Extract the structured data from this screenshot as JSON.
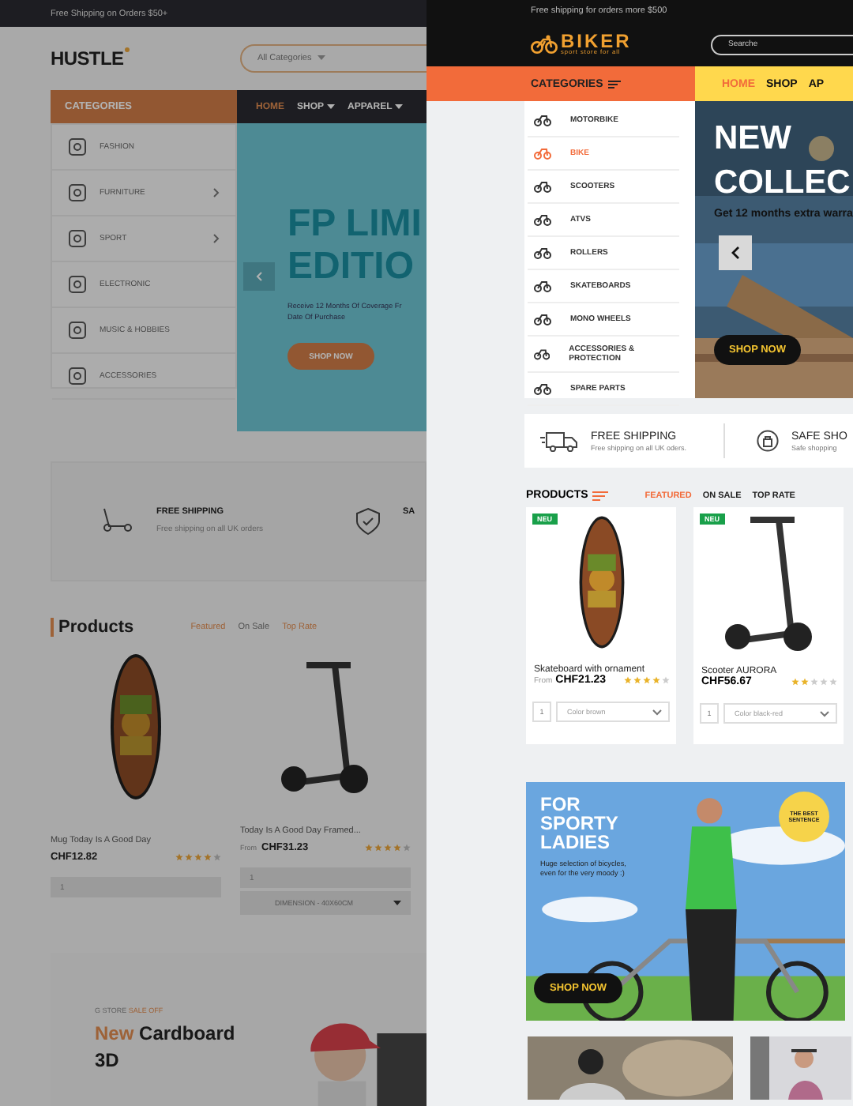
{
  "left_site": {
    "top_bar": "Free Shipping on Orders $50+",
    "logo": "HUSTLE",
    "search": {
      "category": "All Categories"
    },
    "categories_title": "CATEGORIES",
    "nav": [
      {
        "label": "HOME",
        "selected": true,
        "dropdown": false
      },
      {
        "label": "SHOP",
        "selected": false,
        "dropdown": true
      },
      {
        "label": "APPAREL",
        "selected": false,
        "dropdown": true
      }
    ],
    "categories": [
      {
        "label": "FASHION",
        "submenu": false
      },
      {
        "label": "FURNITURE",
        "submenu": true
      },
      {
        "label": "SPORT",
        "submenu": true
      },
      {
        "label": "ELECTRONIC",
        "submenu": false
      },
      {
        "label": "MUSIC & HOBBIES",
        "submenu": false
      },
      {
        "label": "ACCESSORIES",
        "submenu": false
      }
    ],
    "hero": {
      "title_lines": [
        "FP LIMI",
        "EDITIO"
      ],
      "text_lines": [
        "Receive 12 Months Of Coverage Fr",
        "Date Of Purchase"
      ],
      "button": "SHOP NOW"
    },
    "features": [
      {
        "title": "FREE SHIPPING",
        "text": "Free shipping on all UK orders"
      },
      {
        "title": "SA"
      }
    ],
    "products_title": "Products",
    "product_tabs": [
      {
        "label": "Featured",
        "highlighted": true
      },
      {
        "label": "On Sale",
        "highlighted": false
      },
      {
        "label": "Top Rate",
        "highlighted": true
      }
    ],
    "products": [
      {
        "kind": "skateboard",
        "name": "Mug Today Is A Good Day",
        "price": "CHF12.82",
        "stars": 4,
        "quantity": "1"
      },
      {
        "kind": "scooter",
        "name": "Today Is A Good Day Framed...",
        "price_prefix": "From",
        "price": "CHF31.23",
        "stars": 4,
        "quantity": "1",
        "option": "DIMENSION - 40X60CM"
      }
    ],
    "banner": {
      "eyebrow": "G STORE",
      "eyebrow_accent": "SALE OFF",
      "title_accent": "New",
      "title": "Cardboard 3D"
    }
  },
  "right_site": {
    "top_bar": "Free  shipping for orders more $500",
    "logo": "BIKER",
    "tagline": "sport store for all",
    "search": {
      "placeholder": "Searche"
    },
    "categories_title": "CATEGORIES",
    "nav": [
      {
        "label": "HOME",
        "selected": true
      },
      {
        "label": "SHOP",
        "selected": false
      },
      {
        "label": "AP",
        "selected": false
      }
    ],
    "categories": [
      {
        "label": "MOTORBIKE",
        "selected": false
      },
      {
        "label": "BIKE",
        "selected": true
      },
      {
        "label": "SCOOTERS",
        "selected": false
      },
      {
        "label": "ATVS",
        "selected": false
      },
      {
        "label": "ROLLERS",
        "selected": false
      },
      {
        "label": "SKATEBOARDS",
        "selected": false
      },
      {
        "label": "MONO WHEELS",
        "selected": false
      },
      {
        "label": "ACCESSORIES & PROTECTION",
        "selected": false
      },
      {
        "label": "SPARE PARTS",
        "selected": false
      }
    ],
    "hero": {
      "title_lines": [
        "NEW",
        "COLLEC"
      ],
      "text": "Get 12 months extra warra",
      "button": "SHOP NOW"
    },
    "features": [
      {
        "title": "FREE SHIPPING",
        "text": "Free shipping on all UK oders."
      },
      {
        "title": "SAFE SHO",
        "text": "Safe shopping"
      }
    ],
    "products_title": "PRODUCTS",
    "product_tabs": [
      {
        "label": "FEATURED",
        "selected": true
      },
      {
        "label": "ON SALE",
        "selected": false
      },
      {
        "label": "TOP RATE",
        "selected": false
      }
    ],
    "products": [
      {
        "kind": "skateboard",
        "badge": "NEU",
        "name": "Skateboard with ornament",
        "price_prefix": "From",
        "price": "CHF21.23",
        "stars": 4,
        "quantity": "1",
        "option": "Color brown"
      },
      {
        "kind": "scooter",
        "badge": "NEU",
        "name": "Scooter AURORA",
        "price": "CHF56.67",
        "stars": 2,
        "quantity": "1",
        "option": "Color black-red"
      }
    ],
    "banner": {
      "title_lines": [
        "FOR",
        "SPORTY",
        "LADIES"
      ],
      "text": "Huge selection of bicycles, even for the very moody :)",
      "sticker": "THE BEST SENTENCE",
      "button": "SHOP NOW"
    }
  }
}
